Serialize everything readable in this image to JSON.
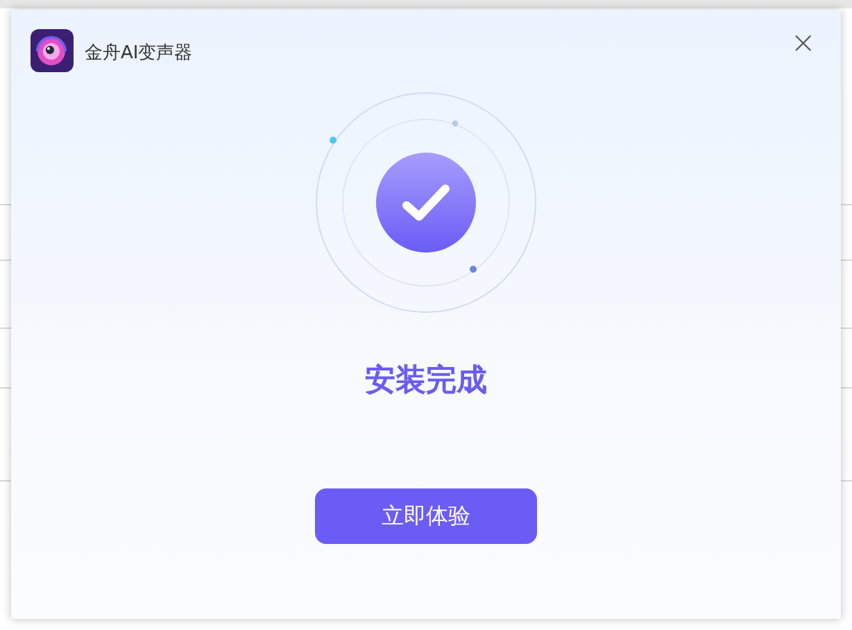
{
  "window": {
    "title": "金舟AI变声器",
    "close": "×"
  },
  "status": {
    "heading": "安装完成"
  },
  "buttons": [
    "立即体验"
  ]
}
